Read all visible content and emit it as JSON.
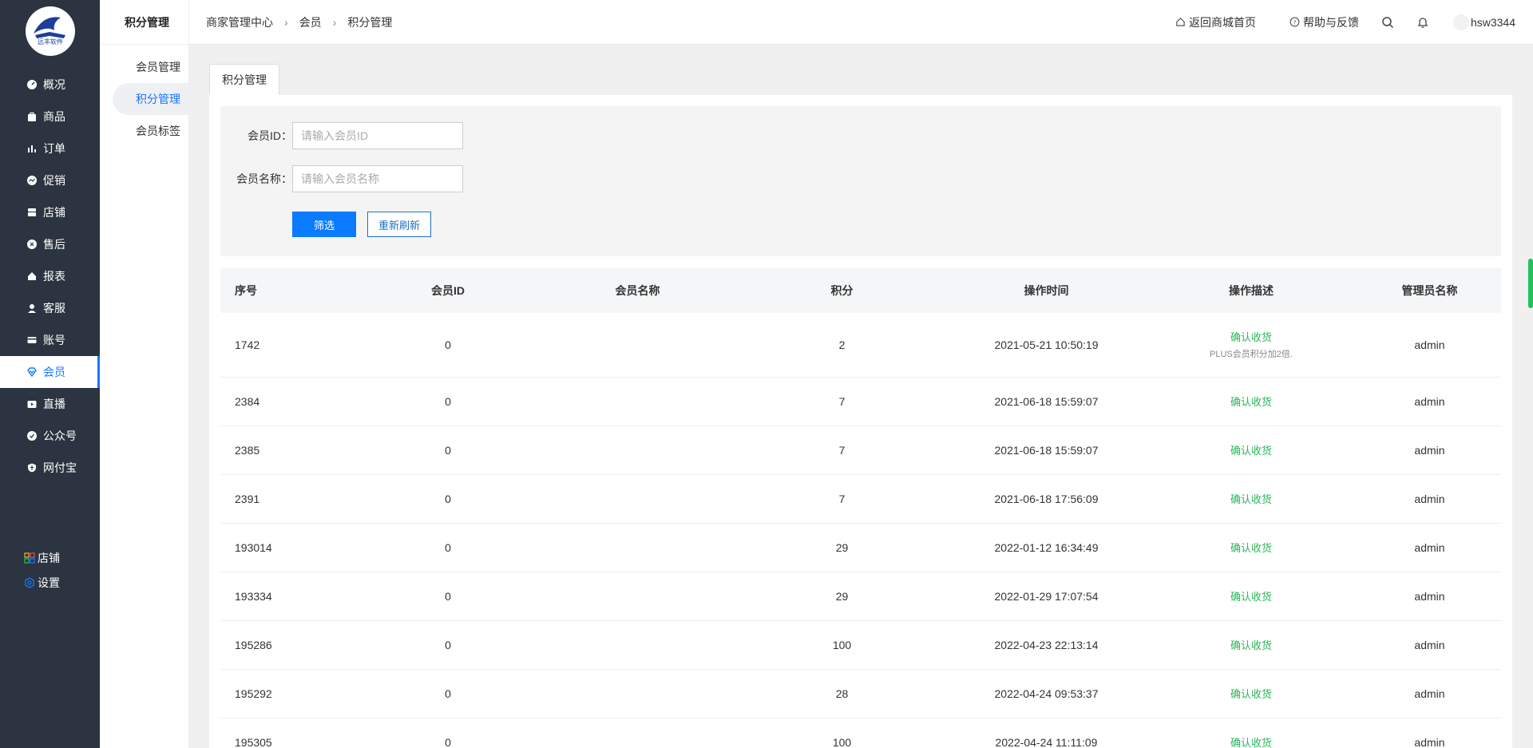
{
  "sidebar": {
    "logo_text": "远丰软件",
    "items": [
      {
        "label": "概况",
        "icon": "dashboard-icon"
      },
      {
        "label": "商品",
        "icon": "goods-icon"
      },
      {
        "label": "订单",
        "icon": "order-icon"
      },
      {
        "label": "促销",
        "icon": "promotion-icon"
      },
      {
        "label": "店铺",
        "icon": "store-icon"
      },
      {
        "label": "售后",
        "icon": "aftersale-icon"
      },
      {
        "label": "报表",
        "icon": "report-icon"
      },
      {
        "label": "客服",
        "icon": "service-icon"
      },
      {
        "label": "账号",
        "icon": "account-icon"
      },
      {
        "label": "会员",
        "icon": "member-icon",
        "active": true
      },
      {
        "label": "直播",
        "icon": "live-icon"
      },
      {
        "label": "公众号",
        "icon": "wechat-icon"
      },
      {
        "label": "网付宝",
        "icon": "pay-icon"
      }
    ],
    "bottom": [
      {
        "label": "店铺",
        "icon": "grid-icon"
      },
      {
        "label": "设置",
        "icon": "settings-icon"
      }
    ]
  },
  "subnav": {
    "title": "积分管理",
    "items": [
      {
        "label": "会员管理"
      },
      {
        "label": "积分管理",
        "active": true
      },
      {
        "label": "会员标签"
      }
    ]
  },
  "header": {
    "breadcrumb": [
      "商家管理中心",
      "会员",
      "积分管理"
    ],
    "home_link": "返回商城首页",
    "help_link": "帮助与反馈",
    "username": "hsw3344"
  },
  "tabs": [
    "积分管理"
  ],
  "filter": {
    "member_id_label": "会员ID：",
    "member_id_placeholder": "请输入会员ID",
    "member_id_value": "",
    "member_name_label": "会员名称：",
    "member_name_placeholder": "请输入会员名称",
    "member_name_value": "",
    "filter_button": "筛选",
    "reset_button": "重新刷新"
  },
  "table": {
    "columns": [
      "序号",
      "会员ID",
      "会员名称",
      "积分",
      "操作时间",
      "操作描述",
      "管理员名称"
    ],
    "rows": [
      {
        "seq": "1742",
        "member_id": "0",
        "name": "",
        "points": "2",
        "time": "2021-05-21 10:50:19",
        "desc": "确认收货",
        "desc_sub": "PLUS会员积分加2倍.",
        "admin": "admin"
      },
      {
        "seq": "2384",
        "member_id": "0",
        "name": "",
        "points": "7",
        "time": "2021-06-18 15:59:07",
        "desc": "确认收货",
        "desc_sub": "",
        "admin": "admin"
      },
      {
        "seq": "2385",
        "member_id": "0",
        "name": "",
        "points": "7",
        "time": "2021-06-18 15:59:07",
        "desc": "确认收货",
        "desc_sub": "",
        "admin": "admin"
      },
      {
        "seq": "2391",
        "member_id": "0",
        "name": "",
        "points": "7",
        "time": "2021-06-18 17:56:09",
        "desc": "确认收货",
        "desc_sub": "",
        "admin": "admin"
      },
      {
        "seq": "193014",
        "member_id": "0",
        "name": "",
        "points": "29",
        "time": "2022-01-12 16:34:49",
        "desc": "确认收货",
        "desc_sub": "",
        "admin": "admin"
      },
      {
        "seq": "193334",
        "member_id": "0",
        "name": "",
        "points": "29",
        "time": "2022-01-29 17:07:54",
        "desc": "确认收货",
        "desc_sub": "",
        "admin": "admin"
      },
      {
        "seq": "195286",
        "member_id": "0",
        "name": "",
        "points": "100",
        "time": "2022-04-23 22:13:14",
        "desc": "确认收货",
        "desc_sub": "",
        "admin": "admin"
      },
      {
        "seq": "195292",
        "member_id": "0",
        "name": "",
        "points": "28",
        "time": "2022-04-24 09:53:37",
        "desc": "确认收货",
        "desc_sub": "",
        "admin": "admin"
      },
      {
        "seq": "195305",
        "member_id": "0",
        "name": "",
        "points": "100",
        "time": "2022-04-24 11:11:09",
        "desc": "确认收货",
        "desc_sub": "",
        "admin": "admin"
      }
    ]
  },
  "colors": {
    "sidebar_bg": "#2b3440",
    "accent": "#1677ff",
    "success": "#2ab75a"
  }
}
